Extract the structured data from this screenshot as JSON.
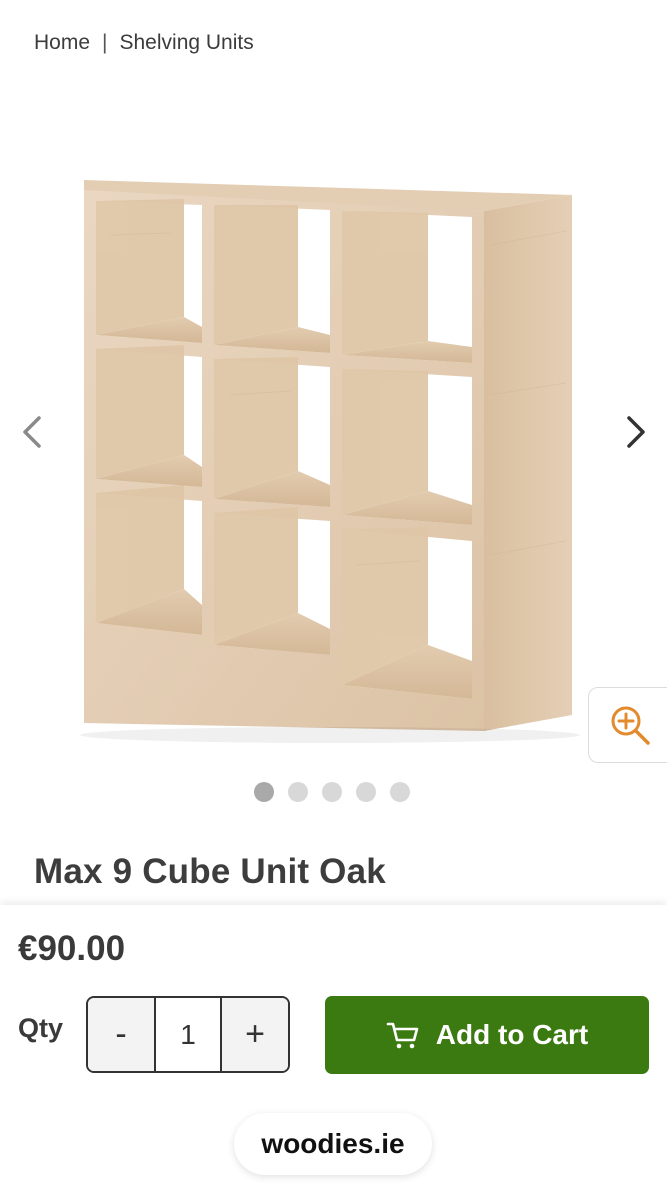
{
  "breadcrumb": {
    "items": [
      "Home",
      "Shelving Units"
    ],
    "separator": "|"
  },
  "gallery": {
    "image_alt": "Max 9 Cube Unit Oak shelving unit",
    "prev_icon": "chevron-left-icon",
    "next_icon": "chevron-right-icon",
    "zoom_icon": "zoom-in-icon",
    "zoom_color": "#e38b2c",
    "dots_total": 5,
    "active_dot": 1
  },
  "product": {
    "title": "Max 9 Cube Unit Oak",
    "price": "€90.00"
  },
  "purchase": {
    "qty_label": "Qty",
    "decrement_label": "-",
    "quantity": "1",
    "increment_label": "+",
    "add_to_cart_label": "Add to Cart",
    "cart_icon": "cart-icon",
    "button_color": "#3b7a10"
  },
  "browser": {
    "site": "woodies.ie"
  }
}
